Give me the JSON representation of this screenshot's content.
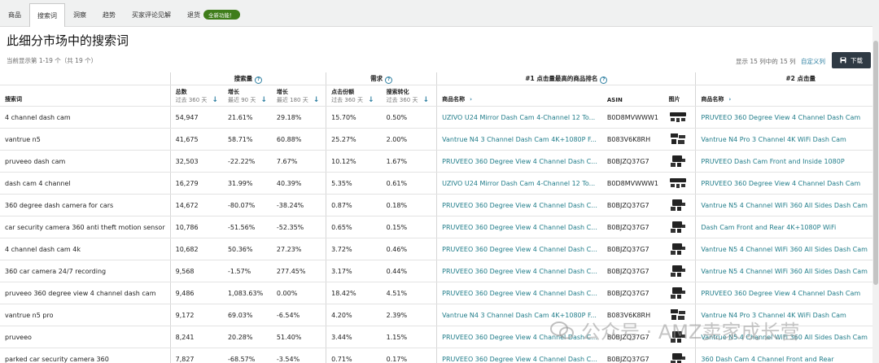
{
  "tabs": [
    {
      "label": "商品",
      "active": false
    },
    {
      "label": "搜索词",
      "active": true
    },
    {
      "label": "洞察",
      "active": false
    },
    {
      "label": "趋势",
      "active": false
    },
    {
      "label": "买家评论见解",
      "active": false
    },
    {
      "label": "退货",
      "active": false,
      "badge": "全新功能！"
    }
  ],
  "page_title": "此细分市场中的搜索词",
  "showing_text": "当前显示第 1-19 个（共 19 个）",
  "columns_info": "显示 15 列中的 15 列",
  "customize_link": "自定义列",
  "download_label": "下载",
  "groups": {
    "search_volume": "搜索量",
    "demand": "需求",
    "rank1": "#1 点击量最高的商品排名",
    "rank2": "#2 点击量"
  },
  "headers": {
    "keyword": "搜索词",
    "total": "总数",
    "total_sub": "过去 360 天",
    "growth90": "增长",
    "growth90_sub": "最近 90 天",
    "growth180": "增长",
    "growth180_sub": "最近 180 天",
    "click_share": "点击份额",
    "click_share_sub": "过去 360 天",
    "conversion": "搜索转化",
    "conversion_sub": "过去 360 天",
    "product_name": "商品名称",
    "asin": "ASIN",
    "image": "图片",
    "product_name2": "商品名称"
  },
  "rows": [
    {
      "keyword": "4 channel dash cam",
      "total": "54,947",
      "g90": "21.61%",
      "g180": "29.18%",
      "click": "15.70%",
      "conv": "0.50%",
      "p1": "UZIVO U24 Mirror Dash Cam 4-Channel 12 To...",
      "asin": "B0D8MVWWW1",
      "img": "mirror",
      "p2": "PRUVEEO 360 Degree View 4 Channel Dash Cam"
    },
    {
      "keyword": "vantrue n5",
      "total": "41,675",
      "g90": "58.71%",
      "g180": "60.88%",
      "click": "25.27%",
      "conv": "2.00%",
      "p1": "Vantrue N4 3 Channel Dash Cam 4K+1080P F...",
      "asin": "B083V6K8RH",
      "img": "kit",
      "p2": "Vantrue N4 Pro 3 Channel 4K WiFi Dash Cam"
    },
    {
      "keyword": "pruveeo dash cam",
      "total": "32,503",
      "g90": "-22.22%",
      "g180": "7.67%",
      "click": "10.12%",
      "conv": "1.67%",
      "p1": "PRUVEEO 360 Degree View 4 Channel Dash C...",
      "asin": "B0BJZQ37G7",
      "img": "cam",
      "p2": "PRUVEEO Dash Cam Front and Inside 1080P"
    },
    {
      "keyword": "dash cam 4 channel",
      "total": "16,279",
      "g90": "31.99%",
      "g180": "40.39%",
      "click": "5.35%",
      "conv": "0.61%",
      "p1": "UZIVO U24 Mirror Dash Cam 4-Channel 12 To...",
      "asin": "B0D8MVWWW1",
      "img": "mirror",
      "p2": "PRUVEEO 360 Degree View 4 Channel Dash Cam"
    },
    {
      "keyword": "360 degree dash camera for cars",
      "total": "14,672",
      "g90": "-80.07%",
      "g180": "-38.24%",
      "click": "0.87%",
      "conv": "0.18%",
      "p1": "PRUVEEO 360 Degree View 4 Channel Dash C...",
      "asin": "B0BJZQ37G7",
      "img": "cam",
      "p2": "Vantrue N5 4 Channel WiFi 360 All Sides Dash Cam"
    },
    {
      "keyword": "car security camera 360 anti theft motion sensor",
      "total": "10,786",
      "g90": "-51.56%",
      "g180": "-52.35%",
      "click": "0.65%",
      "conv": "0.15%",
      "p1": "PRUVEEO 360 Degree View 4 Channel Dash C...",
      "asin": "B0BJZQ37G7",
      "img": "cam",
      "p2": "Dash Cam Front and Rear 4K+1080P WiFi"
    },
    {
      "keyword": "4 channel dash cam 4k",
      "total": "10,682",
      "g90": "50.36%",
      "g180": "27.23%",
      "click": "3.72%",
      "conv": "0.46%",
      "p1": "PRUVEEO 360 Degree View 4 Channel Dash C...",
      "asin": "B0BJZQ37G7",
      "img": "cam",
      "p2": "Vantrue N5 4 Channel WiFi 360 All Sides Dash Cam"
    },
    {
      "keyword": "360 car camera 24/7 recording",
      "total": "9,568",
      "g90": "-1.57%",
      "g180": "277.45%",
      "click": "3.17%",
      "conv": "0.44%",
      "p1": "PRUVEEO 360 Degree View 4 Channel Dash C...",
      "asin": "B0BJZQ37G7",
      "img": "cam",
      "p2": "Vantrue N5 4 Channel WiFi 360 All Sides Dash Cam"
    },
    {
      "keyword": "pruveeo 360 degree view 4 channel dash cam",
      "total": "9,486",
      "g90": "1,083.63%",
      "g180": "0.00%",
      "click": "18.42%",
      "conv": "4.51%",
      "p1": "PRUVEEO 360 Degree View 4 Channel Dash C...",
      "asin": "B0BJZQ37G7",
      "img": "cam",
      "p2": "PRUVEEO 360 Degree View 4 Channel Dash Cam"
    },
    {
      "keyword": "vantrue n5 pro",
      "total": "9,172",
      "g90": "69.03%",
      "g180": "-6.54%",
      "click": "4.20%",
      "conv": "2.39%",
      "p1": "Vantrue N4 3 Channel Dash Cam 4K+1080P F...",
      "asin": "B083V6K8RH",
      "img": "kit",
      "p2": "Vantrue N4 Pro 3 Channel 4K WiFi Dash Cam"
    },
    {
      "keyword": "pruveeo",
      "total": "8,241",
      "g90": "20.28%",
      "g180": "51.40%",
      "click": "3.44%",
      "conv": "1.15%",
      "p1": "PRUVEEO 360 Degree View 4 Channel Dash C...",
      "asin": "B0BJZQ37G7",
      "img": "cam",
      "p2": "Vantrue N5 4 Channel WiFi 360 All Sides Dash Cam"
    },
    {
      "keyword": "parked car security camera 360",
      "total": "7,827",
      "g90": "-68.57%",
      "g180": "-3.54%",
      "click": "0.71%",
      "conv": "0.17%",
      "p1": "PRUVEEO 360 Degree View 4 Channel Dash C...",
      "asin": "B0BJZQ37G7",
      "img": "cam",
      "p2": "360 Dash Cam 4 Channel Front and Rear"
    }
  ],
  "watermark": "公众号 · AMZ卖家成长营"
}
